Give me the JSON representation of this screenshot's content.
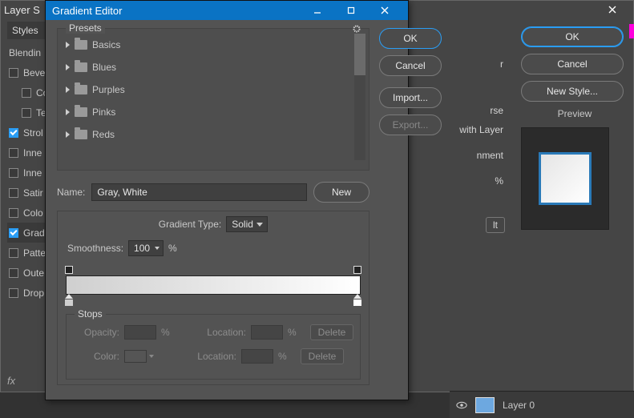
{
  "layer_style": {
    "title": "Layer S",
    "styles_header": "Styles",
    "blending_label": "Blendin",
    "effects": [
      {
        "label": "Beve",
        "checked": false,
        "indent": 0
      },
      {
        "label": "Co",
        "checked": false,
        "indent": 1
      },
      {
        "label": "Te",
        "checked": false,
        "indent": 1
      },
      {
        "label": "Strol",
        "checked": true,
        "indent": 0
      },
      {
        "label": "Inne",
        "checked": false,
        "indent": 0
      },
      {
        "label": "Inne",
        "checked": false,
        "indent": 0
      },
      {
        "label": "Satir",
        "checked": false,
        "indent": 0
      },
      {
        "label": "Colo",
        "checked": false,
        "indent": 0
      },
      {
        "label": "Grad",
        "checked": true,
        "indent": 0
      },
      {
        "label": "Patte",
        "checked": false,
        "indent": 0
      },
      {
        "label": "Oute",
        "checked": false,
        "indent": 0
      },
      {
        "label": "Drop",
        "checked": false,
        "indent": 0
      }
    ],
    "footer": "fx",
    "mid_fragments": {
      "f1": "r",
      "f2": "rse",
      "f3": "with Layer",
      "f4": "nment",
      "f5": "%",
      "f6": "lt"
    },
    "buttons": {
      "ok": "OK",
      "cancel": "Cancel",
      "new_style": "New Style...",
      "preview": "Preview"
    }
  },
  "gradient_editor": {
    "title": "Gradient Editor",
    "presets_label": "Presets",
    "preset_folders": [
      "Basics",
      "Blues",
      "Purples",
      "Pinks",
      "Reds"
    ],
    "name_label": "Name:",
    "name_value": "Gray, White",
    "new_btn": "New",
    "gradient_type_label": "Gradient Type:",
    "gradient_type_value": "Solid",
    "smoothness_label": "Smoothness:",
    "smoothness_value": "100",
    "pct": "%",
    "stops_label": "Stops",
    "opacity_label": "Opacity:",
    "color_label": "Color:",
    "location_label": "Location:",
    "delete_label": "Delete",
    "buttons": {
      "ok": "OK",
      "cancel": "Cancel",
      "import": "Import...",
      "export": "Export..."
    }
  },
  "layers_panel": {
    "layer_name": "Layer 0"
  }
}
